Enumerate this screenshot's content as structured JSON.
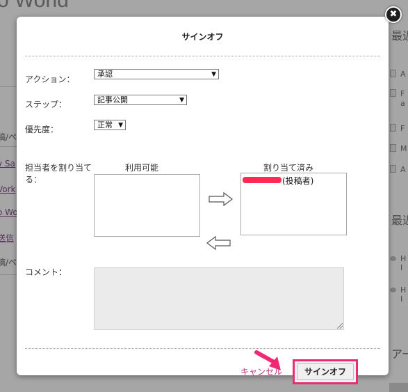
{
  "background": {
    "title": "o World",
    "left_items": [
      "稿/ペ",
      "v Sa",
      "Vork",
      "o Wo",
      "送信",
      "稿/ペ"
    ],
    "right": {
      "head1": "最近",
      "rows1": [
        "A",
        "F",
        "a",
        "F",
        "M",
        "A"
      ],
      "head2": "最近",
      "rows2": [
        "H",
        "I",
        "H",
        "I"
      ],
      "head3": "アー"
    }
  },
  "modal": {
    "title": "サインオフ",
    "close_glyph": "✖",
    "action": {
      "label": "アクション：",
      "value": "承認"
    },
    "step": {
      "label": "ステップ：",
      "value": "記事公開"
    },
    "priority": {
      "label": "優先度：",
      "value": "正常"
    },
    "assignee": {
      "label_line1": "担当者を割り当て",
      "label_line2": "る：",
      "available_header": "利用可能",
      "assigned_header": "割り当て済み",
      "assigned_suffix": "(投稿者)"
    },
    "comment": {
      "label": "コメント："
    },
    "cancel_label": "キャンセル",
    "submit_label": "サインオフ"
  },
  "colors": {
    "highlight": "#ee2a75",
    "cancel_link": "#b8317a"
  }
}
